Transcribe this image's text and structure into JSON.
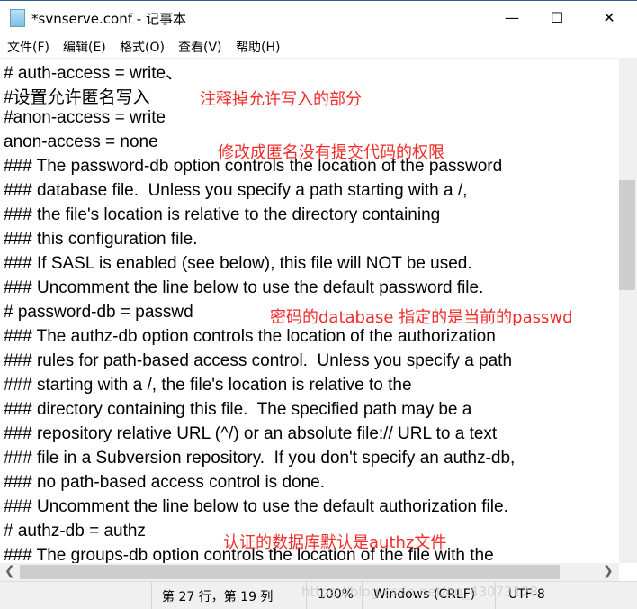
{
  "window": {
    "title": "*svnserve.conf - 记事本",
    "minimize": "—",
    "maximize": "☐",
    "close": "✕",
    "icon": "notepad-icon"
  },
  "menu": [
    "文件(F)",
    "编辑(E)",
    "格式(O)",
    "查看(V)",
    "帮助(H)"
  ],
  "lines": [
    "# auth-access = write、",
    "#设置允许匿名写入",
    "#anon-access = write",
    "anon-access = none",
    "### The password-db option controls the location of the password",
    "### database file.  Unless you specify a path starting with a /,",
    "### the file's location is relative to the directory containing",
    "### this configuration file.",
    "### If SASL is enabled (see below), this file will NOT be used.",
    "### Uncomment the line below to use the default password file.",
    "# password-db = passwd",
    "### The authz-db option controls the location of the authorization",
    "### rules for path-based access control.  Unless you specify a path",
    "### starting with a /, the file's location is relative to the",
    "### directory containing this file.  The specified path may be a",
    "### repository relative URL (^/) or an absolute file:// URL to a text",
    "### file in a Subversion repository.  If you don't specify an authz-db,",
    "### no path-based access control is done.",
    "### Uncomment the line below to use the default authorization file.",
    "# authz-db = authz",
    "### The groups-db option controls the location of the file with the"
  ],
  "notes": [
    "注释掉允许写入的部分",
    "修改成匿名没有提交代码的权限",
    "密码的database 指定的是当前的passwd",
    "认证的数据库默认是authz文件"
  ],
  "status": {
    "position": "第 27 行，第 19 列",
    "zoom": "100%",
    "line_ending": "Windows (CRLF)",
    "encoding": "UTF-8"
  },
  "watermark": "https://blog.csdn.net/qq_43073128",
  "colors": {
    "annotation": "#f02d2d"
  }
}
